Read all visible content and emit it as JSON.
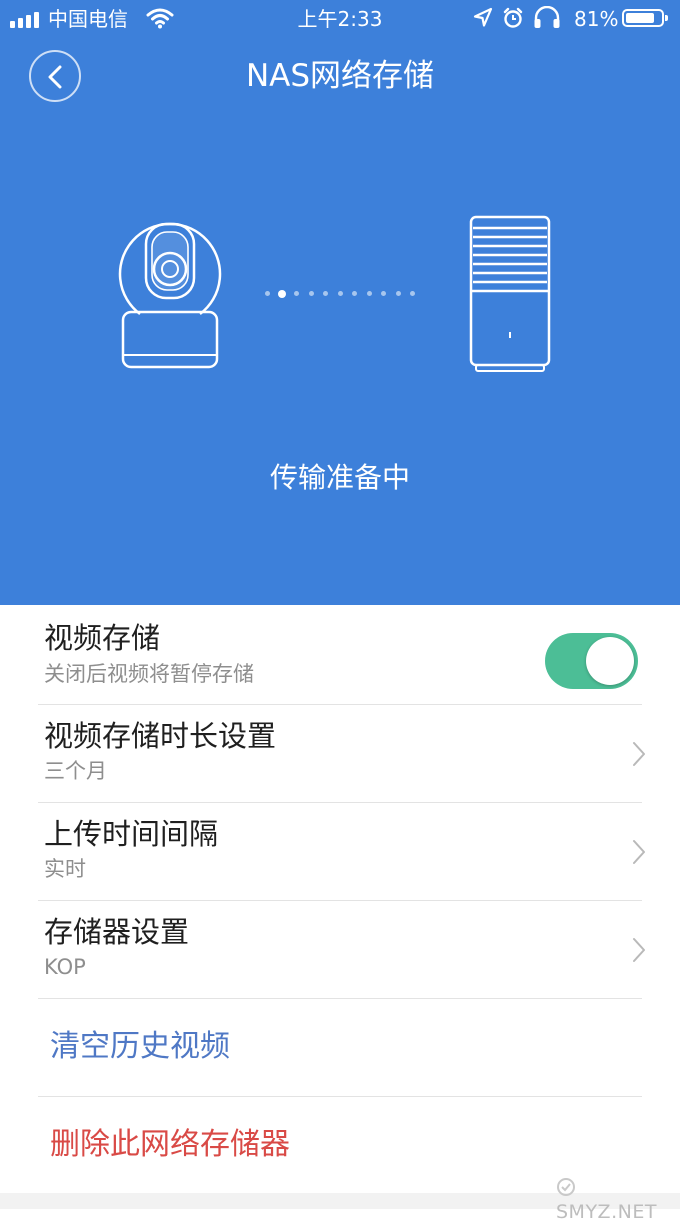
{
  "status_bar": {
    "carrier": "中国电信",
    "time": "上午2:33",
    "battery": "81%",
    "battery_level": 0.81,
    "icons": [
      "signal-icon",
      "wifi-icon",
      "location-arrow-icon",
      "alarm-icon",
      "headphones-icon",
      "battery-icon"
    ]
  },
  "header": {
    "title": "NAS网络存储",
    "back_icon": "chevron-left-icon"
  },
  "hero": {
    "device_icon": "camera-icon",
    "target_icon": "nas-device-icon",
    "progress_dots": 11,
    "active_dot": 2,
    "status": "传输准备中",
    "background": "#3d80da"
  },
  "settings": {
    "video_storage": {
      "title": "视频存储",
      "subtitle": "关闭后视频将暂停存储",
      "enabled": true,
      "toggle_color": "#4cbe96"
    },
    "retention": {
      "title": "视频存储时长设置",
      "value": "三个月"
    },
    "upload_interval": {
      "title": "上传时间间隔",
      "value": "实时"
    },
    "storage_device": {
      "title": "存储器设置",
      "value": "KOP"
    },
    "clear_history": {
      "label": "清空历史视频",
      "color": "#4f78c5"
    },
    "delete_storage": {
      "label": "删除此网络存储器",
      "color": "#d94a46"
    }
  },
  "watermark": "SMYZ.NET"
}
